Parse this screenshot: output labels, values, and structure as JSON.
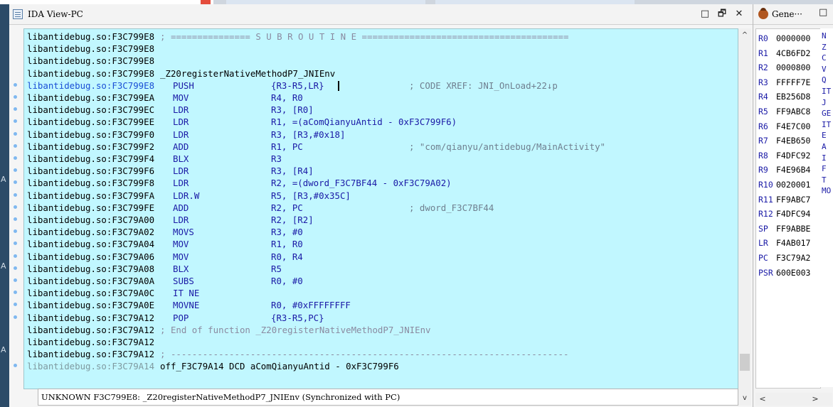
{
  "ida_view": {
    "title": "IDA View-PC",
    "window_buttons": {
      "restore": "□",
      "float": "🗗",
      "close": "✕"
    },
    "lines": [
      {
        "addr": "libantidebug.so:F3C799E8",
        "mn": "",
        "op": "",
        "cmt": "; =============== S U B R O U T I N E =======================================",
        "kind": "cmt",
        "bp": false
      },
      {
        "addr": "libantidebug.so:F3C799E8",
        "mn": "",
        "op": "",
        "cmt": "",
        "kind": "plain",
        "bp": false
      },
      {
        "addr": "libantidebug.so:F3C799E8",
        "mn": "",
        "op": "",
        "cmt": "",
        "kind": "plain",
        "bp": false
      },
      {
        "addr": "libantidebug.so:F3C799E8",
        "mn": "_Z20registerNativeMethodP7_JNIEnv",
        "op": "",
        "cmt": "",
        "kind": "label",
        "bp": false
      },
      {
        "addr": "libantidebug.so:F3C799E8",
        "mn": "PUSH",
        "op": "{R3-R5,LR}",
        "cmt": "; CODE XREF: JNI_OnLoad+22↓p",
        "kind": "hl",
        "bp": true
      },
      {
        "addr": "libantidebug.so:F3C799EA",
        "mn": "MOV",
        "op": "R4, R0",
        "cmt": "",
        "kind": "plain",
        "bp": true
      },
      {
        "addr": "libantidebug.so:F3C799EC",
        "mn": "LDR",
        "op": "R3, [R0]",
        "cmt": "",
        "kind": "plain",
        "bp": true
      },
      {
        "addr": "libantidebug.so:F3C799EE",
        "mn": "LDR",
        "op": "R1, =(aComQianyuAntid - 0xF3C799F6)",
        "cmt": "",
        "kind": "plain",
        "bp": true
      },
      {
        "addr": "libantidebug.so:F3C799F0",
        "mn": "LDR",
        "op": "R3, [R3,#0x18]",
        "cmt": "",
        "kind": "plain",
        "bp": true
      },
      {
        "addr": "libantidebug.so:F3C799F2",
        "mn": "ADD",
        "op": "R1, PC",
        "cmt": "; \"com/qianyu/antidebug/MainActivity\"",
        "kind": "plain",
        "bp": true
      },
      {
        "addr": "libantidebug.so:F3C799F4",
        "mn": "BLX",
        "op": "R3",
        "cmt": "",
        "kind": "plain",
        "bp": true
      },
      {
        "addr": "libantidebug.so:F3C799F6",
        "mn": "LDR",
        "op": "R3, [R4]",
        "cmt": "",
        "kind": "plain",
        "bp": true
      },
      {
        "addr": "libantidebug.so:F3C799F8",
        "mn": "LDR",
        "op": "R2, =(dword_F3C7BF44 - 0xF3C79A02)",
        "cmt": "",
        "kind": "plain",
        "bp": true
      },
      {
        "addr": "libantidebug.so:F3C799FA",
        "mn": "LDR.W",
        "op": "R5, [R3,#0x35C]",
        "cmt": "",
        "kind": "plain",
        "bp": true
      },
      {
        "addr": "libantidebug.so:F3C799FE",
        "mn": "ADD",
        "op": "R2, PC",
        "cmt": "; dword_F3C7BF44",
        "kind": "plain",
        "bp": true
      },
      {
        "addr": "libantidebug.so:F3C79A00",
        "mn": "LDR",
        "op": "R2, [R2]",
        "cmt": "",
        "kind": "plain",
        "bp": true
      },
      {
        "addr": "libantidebug.so:F3C79A02",
        "mn": "MOVS",
        "op": "R3, #0",
        "cmt": "",
        "kind": "plain",
        "bp": true
      },
      {
        "addr": "libantidebug.so:F3C79A04",
        "mn": "MOV",
        "op": "R1, R0",
        "cmt": "",
        "kind": "plain",
        "bp": true
      },
      {
        "addr": "libantidebug.so:F3C79A06",
        "mn": "MOV",
        "op": "R0, R4",
        "cmt": "",
        "kind": "plain",
        "bp": true
      },
      {
        "addr": "libantidebug.so:F3C79A08",
        "mn": "BLX",
        "op": "R5",
        "cmt": "",
        "kind": "plain",
        "bp": true
      },
      {
        "addr": "libantidebug.so:F3C79A0A",
        "mn": "SUBS",
        "op": "R0, #0",
        "cmt": "",
        "kind": "plain",
        "bp": true
      },
      {
        "addr": "libantidebug.so:F3C79A0C",
        "mn": "IT NE",
        "op": "",
        "cmt": "",
        "kind": "plain",
        "bp": true
      },
      {
        "addr": "libantidebug.so:F3C79A0E",
        "mn": "MOVNE",
        "op": "R0, #0xFFFFFFFF",
        "cmt": "",
        "kind": "plain",
        "bp": true
      },
      {
        "addr": "libantidebug.so:F3C79A12",
        "mn": "POP",
        "op": "{R3-R5,PC}",
        "cmt": "",
        "kind": "plain",
        "bp": true
      },
      {
        "addr": "libantidebug.so:F3C79A12",
        "mn": "",
        "op": "",
        "cmt": "; End of function _Z20registerNativeMethodP7_JNIEnv",
        "kind": "cmt",
        "bp": false
      },
      {
        "addr": "libantidebug.so:F3C79A12",
        "mn": "",
        "op": "",
        "cmt": "",
        "kind": "plain",
        "bp": false
      },
      {
        "addr": "libantidebug.so:F3C79A12",
        "mn": "",
        "op": "",
        "cmt": "; ---------------------------------------------------------------------------",
        "kind": "cmt",
        "bp": false
      },
      {
        "addr": "libantidebug.so:F3C79A14",
        "mn": "off_F3C79A14 DCD aComQianyuAntid - 0xF3C799F6",
        "op": "",
        "cmt": "",
        "kind": "grey",
        "bp": true
      }
    ],
    "status": "UNKNOWN F3C799E8: _Z20registerNativeMethodP7_JNIEnv (Synchronized with PC)",
    "scroll_up": "^",
    "scroll_down": "v"
  },
  "registers": {
    "title": "Gene···",
    "maximize": "□",
    "rows": [
      {
        "name": "R0",
        "value": "0000000"
      },
      {
        "name": "R1",
        "value": "4CB6FD2"
      },
      {
        "name": "R2",
        "value": "0000800"
      },
      {
        "name": "R3",
        "value": "FFFFF7E"
      },
      {
        "name": "R4",
        "value": "EB256D8"
      },
      {
        "name": "R5",
        "value": "FF9ABC8"
      },
      {
        "name": "R6",
        "value": "F4E7C00"
      },
      {
        "name": "R7",
        "value": "F4EB650"
      },
      {
        "name": "R8",
        "value": "F4DFC92"
      },
      {
        "name": "R9",
        "value": "F4E96B4"
      },
      {
        "name": "R10",
        "value": "0020001"
      },
      {
        "name": "R11",
        "value": "FF9ABC7"
      },
      {
        "name": "R12",
        "value": "F4DFC94"
      },
      {
        "name": "SP",
        "value": "FF9ABBE"
      },
      {
        "name": "LR",
        "value": "F4AB017"
      },
      {
        "name": "PC",
        "value": "F3C79A2"
      },
      {
        "name": "PSR",
        "value": "600E003"
      }
    ],
    "flags": [
      "N",
      "Z",
      "C",
      "V",
      "Q",
      "IT",
      "J",
      "GE",
      "IT",
      "E",
      "A",
      "I",
      "F",
      "T",
      "MO"
    ],
    "scroll_left": "<",
    "scroll_right": ">"
  },
  "left_gutter_marks": [
    "A",
    "A",
    "A"
  ],
  "colors": {
    "disasm_bg": "#c1f7ff",
    "address": "#000000",
    "highlight_address": "#1a4fd6",
    "mnemonic": "#1a1aa6",
    "comment": "#6f7f8f",
    "breakpoint_dot": "#7fb8f0"
  }
}
